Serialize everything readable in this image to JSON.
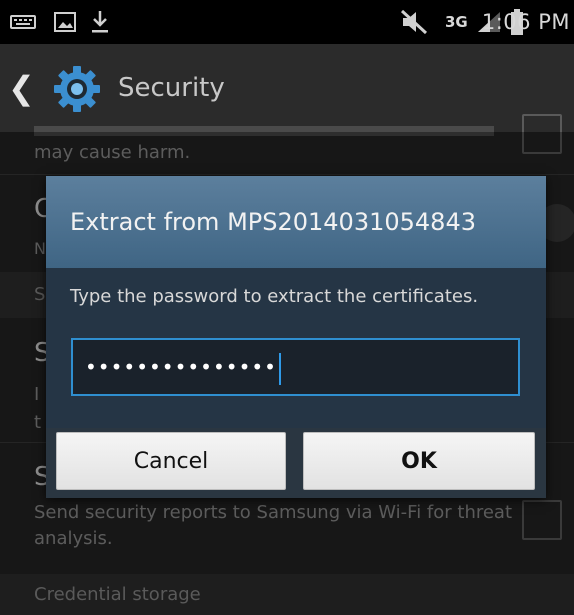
{
  "status_bar": {
    "time": "1:06 PM",
    "network": "3G",
    "icons": [
      "keyboard-icon",
      "image-notification-icon",
      "download-icon",
      "mute-icon",
      "signal-icon",
      "battery-icon"
    ]
  },
  "action_bar": {
    "title": "Security",
    "icon": "gear-icon"
  },
  "settings": {
    "row_top_text": "may cause harm.",
    "row_second_title_partial": "C",
    "row_second_subtitle_partial": "N",
    "section_one_partial": "S",
    "row_third_title_partial": "S",
    "row_third_sub1_partial": "I",
    "row_third_sub2_partial": "t",
    "row_fourth_title_partial": "S",
    "row_fourth_text": "Send security reports to Samsung via Wi-Fi for threat analysis.",
    "section_credential": "Credential storage"
  },
  "dialog": {
    "title": "Extract from MPS2014031054843",
    "message": "Type the password to extract the certificates.",
    "password_value": "•••••••••••••••",
    "cancel_label": "Cancel",
    "ok_label": "OK"
  },
  "colors": {
    "dialog_header": "#4f7393",
    "field_border": "#2f8fd0",
    "background": "#242424"
  }
}
